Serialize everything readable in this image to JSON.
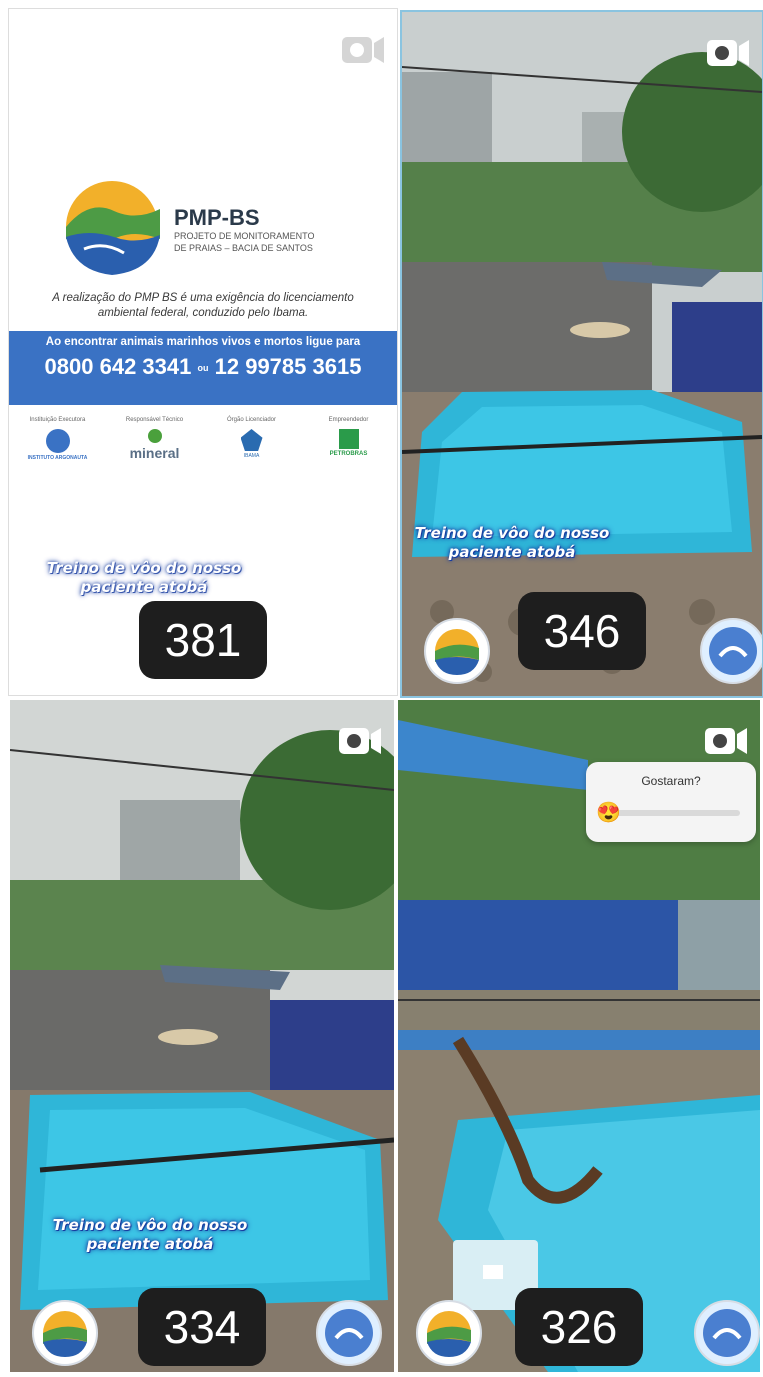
{
  "tiles": [
    {
      "count": "381",
      "caption_line1": "Treino de vôo do nosso",
      "caption_line2": "paciente atobá",
      "brand_name": "PMP-BS",
      "brand_sub1": "PROJETO DE MONITORAMENTO",
      "brand_sub2": "DE PRAIAS – BACIA DE SANTOS",
      "note_line1": "A realização do PMP BS é uma exigência do licenciamento",
      "note_line2": "ambiental federal, conduzido pelo Ibama.",
      "banner_text": "Ao encontrar animais marinhos vivos e mortos ligue para",
      "phone1": "0800 642 3341",
      "phone_sep": "ou",
      "phone2": "12 99785 3615",
      "partners": [
        {
          "label": "Instituição Executora",
          "name": "INSTITUTO ARGONAUTA"
        },
        {
          "label": "Responsável Técnico",
          "name": "mineral"
        },
        {
          "label": "Órgão Licenciador",
          "name": "IBAMA"
        },
        {
          "label": "Empreendedor",
          "name": "PETROBRAS"
        }
      ]
    },
    {
      "count": "346",
      "caption_line1": "Treino de vôo do nosso",
      "caption_line2": "paciente atobá"
    },
    {
      "count": "334",
      "caption_line1": "Treino de vôo do nosso",
      "caption_line2": "paciente atobá"
    },
    {
      "count": "326",
      "poll_question": "Gostaram?",
      "poll_emoji": "😍"
    }
  ],
  "colors": {
    "banner": "#3a72c4",
    "pool": "#2fb6d8",
    "badge_ring": "#d7dde5",
    "counter_bg": "#1e1e1e"
  },
  "icons": [
    "video-camera-icon",
    "pmp-bs-logo",
    "argonauta-logo",
    "heart-eyes-emoji"
  ]
}
